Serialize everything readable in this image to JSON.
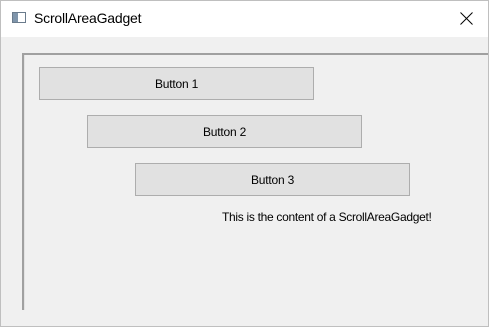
{
  "window": {
    "title": "ScrollAreaGadget",
    "icon": "window-app-icon",
    "close_icon": "close-icon"
  },
  "scroll_area": {
    "buttons": [
      {
        "label": "Button 1"
      },
      {
        "label": "Button 2"
      },
      {
        "label": "Button 3"
      }
    ],
    "content_text": "This is the content of a ScrollAreaGadget!"
  },
  "colors": {
    "window_background": "#f0f0f0",
    "titlebar_background": "#ffffff",
    "button_face": "#e1e1e1",
    "button_border": "#adadad",
    "scroll_area_border": "#a0a0a0"
  }
}
